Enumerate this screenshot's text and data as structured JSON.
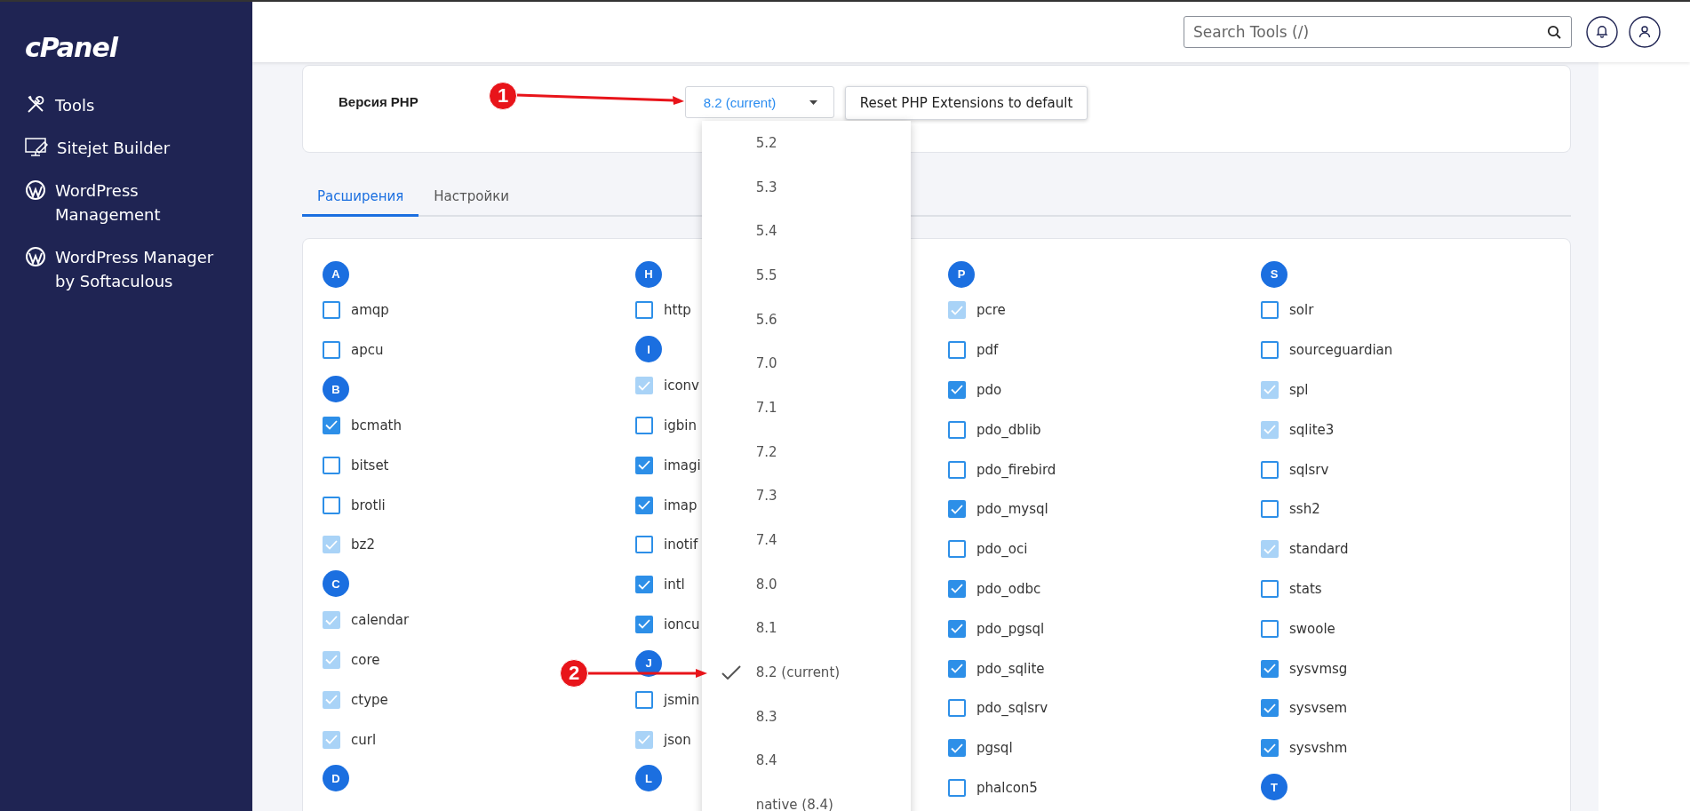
{
  "sidebar": {
    "logo": "cPanel",
    "items": [
      {
        "kind": "tools",
        "label": "Tools"
      },
      {
        "kind": "sitejet",
        "label": "Sitejet Builder"
      },
      {
        "kind": "wordpress",
        "label": "WordPress Management"
      },
      {
        "kind": "wordpress",
        "label": "WordPress Manager by Softaculous"
      }
    ]
  },
  "header": {
    "search": {
      "placeholder": "Search Tools (/)"
    }
  },
  "php_version": {
    "label": "Версия PHP",
    "value": "8.2 (current)",
    "reset_button": "Reset PHP Extensions to default",
    "options": [
      {
        "label": "5.2",
        "selected": false
      },
      {
        "label": "5.3",
        "selected": false
      },
      {
        "label": "5.4",
        "selected": false
      },
      {
        "label": "5.5",
        "selected": false
      },
      {
        "label": "5.6",
        "selected": false
      },
      {
        "label": "7.0",
        "selected": false
      },
      {
        "label": "7.1",
        "selected": false
      },
      {
        "label": "7.2",
        "selected": false
      },
      {
        "label": "7.3",
        "selected": false
      },
      {
        "label": "7.4",
        "selected": false
      },
      {
        "label": "8.0",
        "selected": false
      },
      {
        "label": "8.1",
        "selected": false
      },
      {
        "label": "8.2 (current)",
        "selected": true
      },
      {
        "label": "8.3",
        "selected": false
      },
      {
        "label": "8.4",
        "selected": false
      },
      {
        "label": "native (8.4)",
        "selected": false
      }
    ]
  },
  "tabs": [
    {
      "label": "Расширения",
      "selected": true
    },
    {
      "label": "Настройки",
      "selected": false
    }
  ],
  "extension_columns": [
    [
      {
        "letter": "A",
        "items": [
          {
            "name": "amqp",
            "checked": false,
            "disabled": false
          },
          {
            "name": "apcu",
            "checked": false,
            "disabled": false
          }
        ]
      },
      {
        "letter": "B",
        "items": [
          {
            "name": "bcmath",
            "checked": true,
            "disabled": false
          },
          {
            "name": "bitset",
            "checked": false,
            "disabled": false
          },
          {
            "name": "brotli",
            "checked": false,
            "disabled": false
          },
          {
            "name": "bz2",
            "checked": true,
            "disabled": true
          }
        ]
      },
      {
        "letter": "C",
        "items": [
          {
            "name": "calendar",
            "checked": true,
            "disabled": true
          },
          {
            "name": "core",
            "checked": true,
            "disabled": true
          },
          {
            "name": "ctype",
            "checked": true,
            "disabled": true
          },
          {
            "name": "curl",
            "checked": true,
            "disabled": true
          }
        ]
      },
      {
        "letter": "D"
      }
    ],
    [
      {
        "letter": "H",
        "items": [
          {
            "name": "http",
            "checked": false,
            "disabled": false
          }
        ]
      },
      {
        "letter": "I",
        "items": [
          {
            "name": "iconv",
            "checked": true,
            "disabled": true
          },
          {
            "name": "igbin",
            "checked": false,
            "disabled": false
          },
          {
            "name": "imagi",
            "checked": true,
            "disabled": false
          },
          {
            "name": "imap",
            "checked": true,
            "disabled": false
          },
          {
            "name": "inotif",
            "checked": false,
            "disabled": false
          },
          {
            "name": "intl",
            "checked": true,
            "disabled": false
          },
          {
            "name": "ioncu",
            "checked": true,
            "disabled": false
          }
        ]
      },
      {
        "letter": "J",
        "items": [
          {
            "name": "jsmin",
            "checked": false,
            "disabled": false
          },
          {
            "name": "json",
            "checked": true,
            "disabled": true
          }
        ]
      },
      {
        "letter": "L"
      }
    ],
    [
      {
        "letter": "P",
        "items": [
          {
            "name": "pcre",
            "checked": true,
            "disabled": true
          },
          {
            "name": "pdf",
            "checked": false,
            "disabled": false
          },
          {
            "name": "pdo",
            "checked": true,
            "disabled": false
          },
          {
            "name": "pdo_dblib",
            "checked": false,
            "disabled": false
          },
          {
            "name": "pdo_firebird",
            "checked": false,
            "disabled": false
          },
          {
            "name": "pdo_mysql",
            "checked": true,
            "disabled": false
          },
          {
            "name": "pdo_oci",
            "checked": false,
            "disabled": false
          },
          {
            "name": "pdo_odbc",
            "checked": true,
            "disabled": false
          },
          {
            "name": "pdo_pgsql",
            "checked": true,
            "disabled": false
          },
          {
            "name": "pdo_sqlite",
            "checked": true,
            "disabled": false
          },
          {
            "name": "pdo_sqlsrv",
            "checked": false,
            "disabled": false
          },
          {
            "name": "pgsql",
            "checked": true,
            "disabled": false
          },
          {
            "name": "phalcon5",
            "checked": false,
            "disabled": false
          }
        ]
      }
    ],
    [
      {
        "letter": "S",
        "items": [
          {
            "name": "solr",
            "checked": false,
            "disabled": false
          },
          {
            "name": "sourceguardian",
            "checked": false,
            "disabled": false
          },
          {
            "name": "spl",
            "checked": true,
            "disabled": true
          },
          {
            "name": "sqlite3",
            "checked": true,
            "disabled": true
          },
          {
            "name": "sqlsrv",
            "checked": false,
            "disabled": false
          },
          {
            "name": "ssh2",
            "checked": false,
            "disabled": false
          },
          {
            "name": "standard",
            "checked": true,
            "disabled": true
          },
          {
            "name": "stats",
            "checked": false,
            "disabled": false
          },
          {
            "name": "swoole",
            "checked": false,
            "disabled": false
          },
          {
            "name": "sysvmsg",
            "checked": true,
            "disabled": false
          },
          {
            "name": "sysvsem",
            "checked": true,
            "disabled": false
          },
          {
            "name": "sysvshm",
            "checked": true,
            "disabled": false
          }
        ]
      },
      {
        "letter": "T"
      }
    ]
  ],
  "annotations": [
    {
      "label": "1"
    },
    {
      "label": "2"
    }
  ]
}
